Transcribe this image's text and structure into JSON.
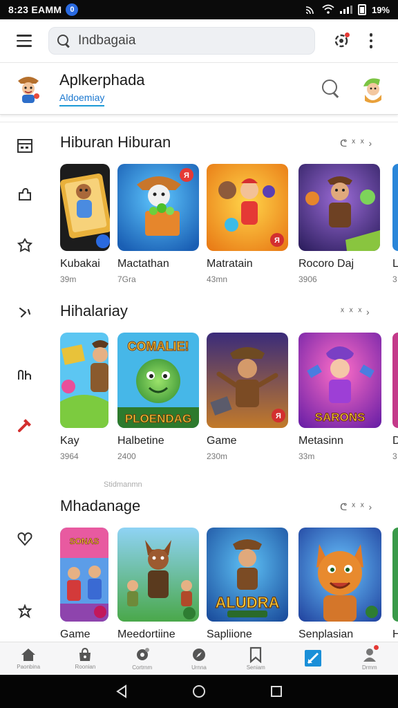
{
  "status_bar": {
    "time": "8:23 EAMM",
    "notif_badge": "0",
    "battery": "19%"
  },
  "top_bar": {
    "search_placeholder": "Indbagaia"
  },
  "header": {
    "title": "Aplkerphada",
    "subtitle": "Aldoemiay"
  },
  "faint_label": "Stidmanmn",
  "sections": [
    {
      "title": "Hiburan Hiburan",
      "more": "ᕦ ᕁ ᕁ ›",
      "items": [
        {
          "name": "Kubakai",
          "meta": "39m"
        },
        {
          "name": "Mactathan",
          "meta": "7Gra"
        },
        {
          "name": "Matratain",
          "meta": "43mn"
        },
        {
          "name": "Rocoro Daj",
          "meta": "3906"
        },
        {
          "name": "L",
          "meta": "3"
        }
      ]
    },
    {
      "title": "Hihalariay",
      "more": "ᕁ ᕁ ᕁ ›",
      "items": [
        {
          "name": "Kay",
          "meta": "3964"
        },
        {
          "name": "Halbetine",
          "meta": "2400"
        },
        {
          "name": "Game",
          "meta": "230m"
        },
        {
          "name": "Metasinn",
          "meta": "33m"
        },
        {
          "name": "D",
          "meta": "3"
        }
      ]
    },
    {
      "title": "Mhadanage",
      "more": "ᕦ ᕁ ᕁ ›",
      "items": [
        {
          "name": "Game",
          "meta": ""
        },
        {
          "name": "Meedortiine",
          "meta": ""
        },
        {
          "name": "Sapliione",
          "meta": ""
        },
        {
          "name": "Senplasian",
          "meta": ""
        },
        {
          "name": "H",
          "meta": ""
        }
      ]
    }
  ],
  "thumb_text": {
    "t2": "Я",
    "t3": "Я",
    "t6a": "COMALIE!",
    "t6b": "PLOENDAG",
    "t7": "Я",
    "t8": "SARONS",
    "t9": "SONAS",
    "t11": "ALUDRA"
  },
  "bottom_nav": [
    {
      "icon": "home-icon",
      "label": "Paonbina"
    },
    {
      "icon": "bag-icon",
      "label": "Roonian"
    },
    {
      "icon": "gear-icon",
      "label": "Cortrnm"
    },
    {
      "icon": "compass-icon",
      "label": "Urnna"
    },
    {
      "icon": "bookmark-icon",
      "label": "Seniam"
    },
    {
      "icon": "tile-icon",
      "label": ""
    },
    {
      "icon": "profile-icon",
      "label": "Drmm"
    }
  ],
  "colors": {
    "accent": "#1b9ad6",
    "active_tab": "#1a8fd8",
    "badge": "#e53935"
  }
}
